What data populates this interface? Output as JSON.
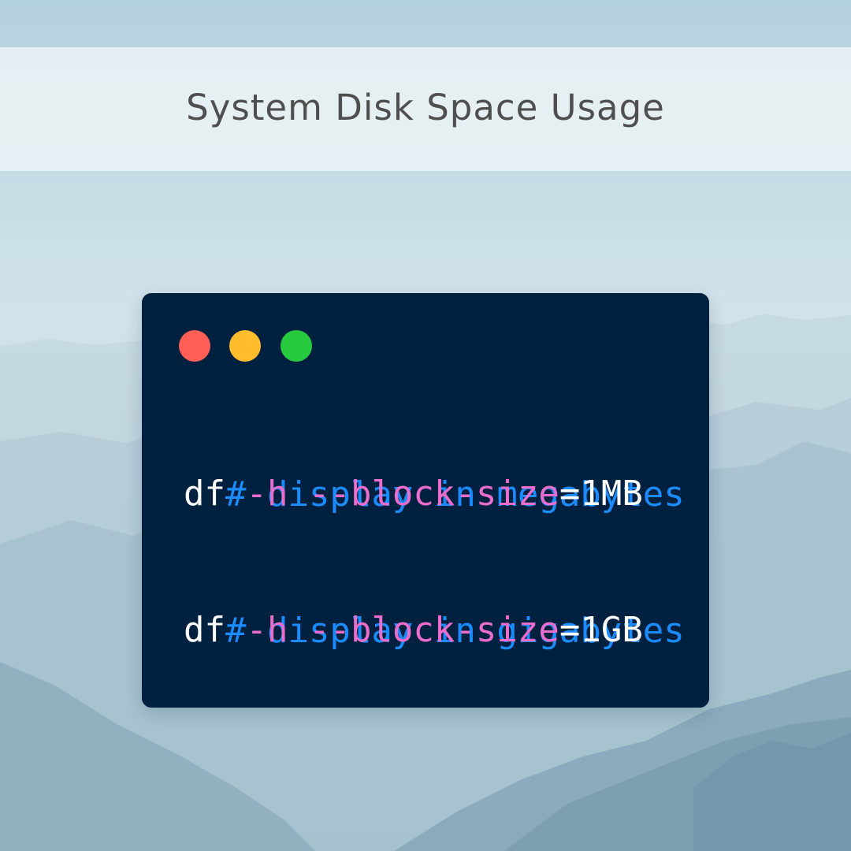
{
  "header": {
    "title": "System Disk Space Usage"
  },
  "terminal": {
    "window_controls": [
      {
        "name": "close",
        "color": "#ff5f56"
      },
      {
        "name": "minimize",
        "color": "#ffbd2e"
      },
      {
        "name": "maximize",
        "color": "#27c93f"
      }
    ],
    "background_color": "#00203f",
    "lines": [
      {
        "comment": "# display in megabytes"
      },
      {
        "command": "df",
        "flag_h": "-h",
        "flag_block": "--block-size",
        "equals_value": "=1MB"
      },
      {
        "comment": "# display in gigabytes"
      },
      {
        "command": "df",
        "flag_h": "-h",
        "flag_block": "--block-size",
        "equals_value": "=1GB"
      }
    ]
  },
  "colors": {
    "comment": "#1a8cff",
    "command": "#ffffff",
    "flag": "#ea6dcc",
    "title_text": "#4f4f4f"
  }
}
